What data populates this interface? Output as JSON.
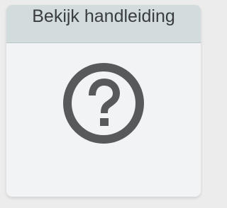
{
  "card": {
    "title": "Bekijk handleiding",
    "icon": "help-circle-icon"
  },
  "colors": {
    "page_background": "#ececec",
    "card_background": "#f2f3f5",
    "header_background": "#d3dcdd",
    "title_text": "#3a3d40",
    "icon": "#58595b"
  }
}
